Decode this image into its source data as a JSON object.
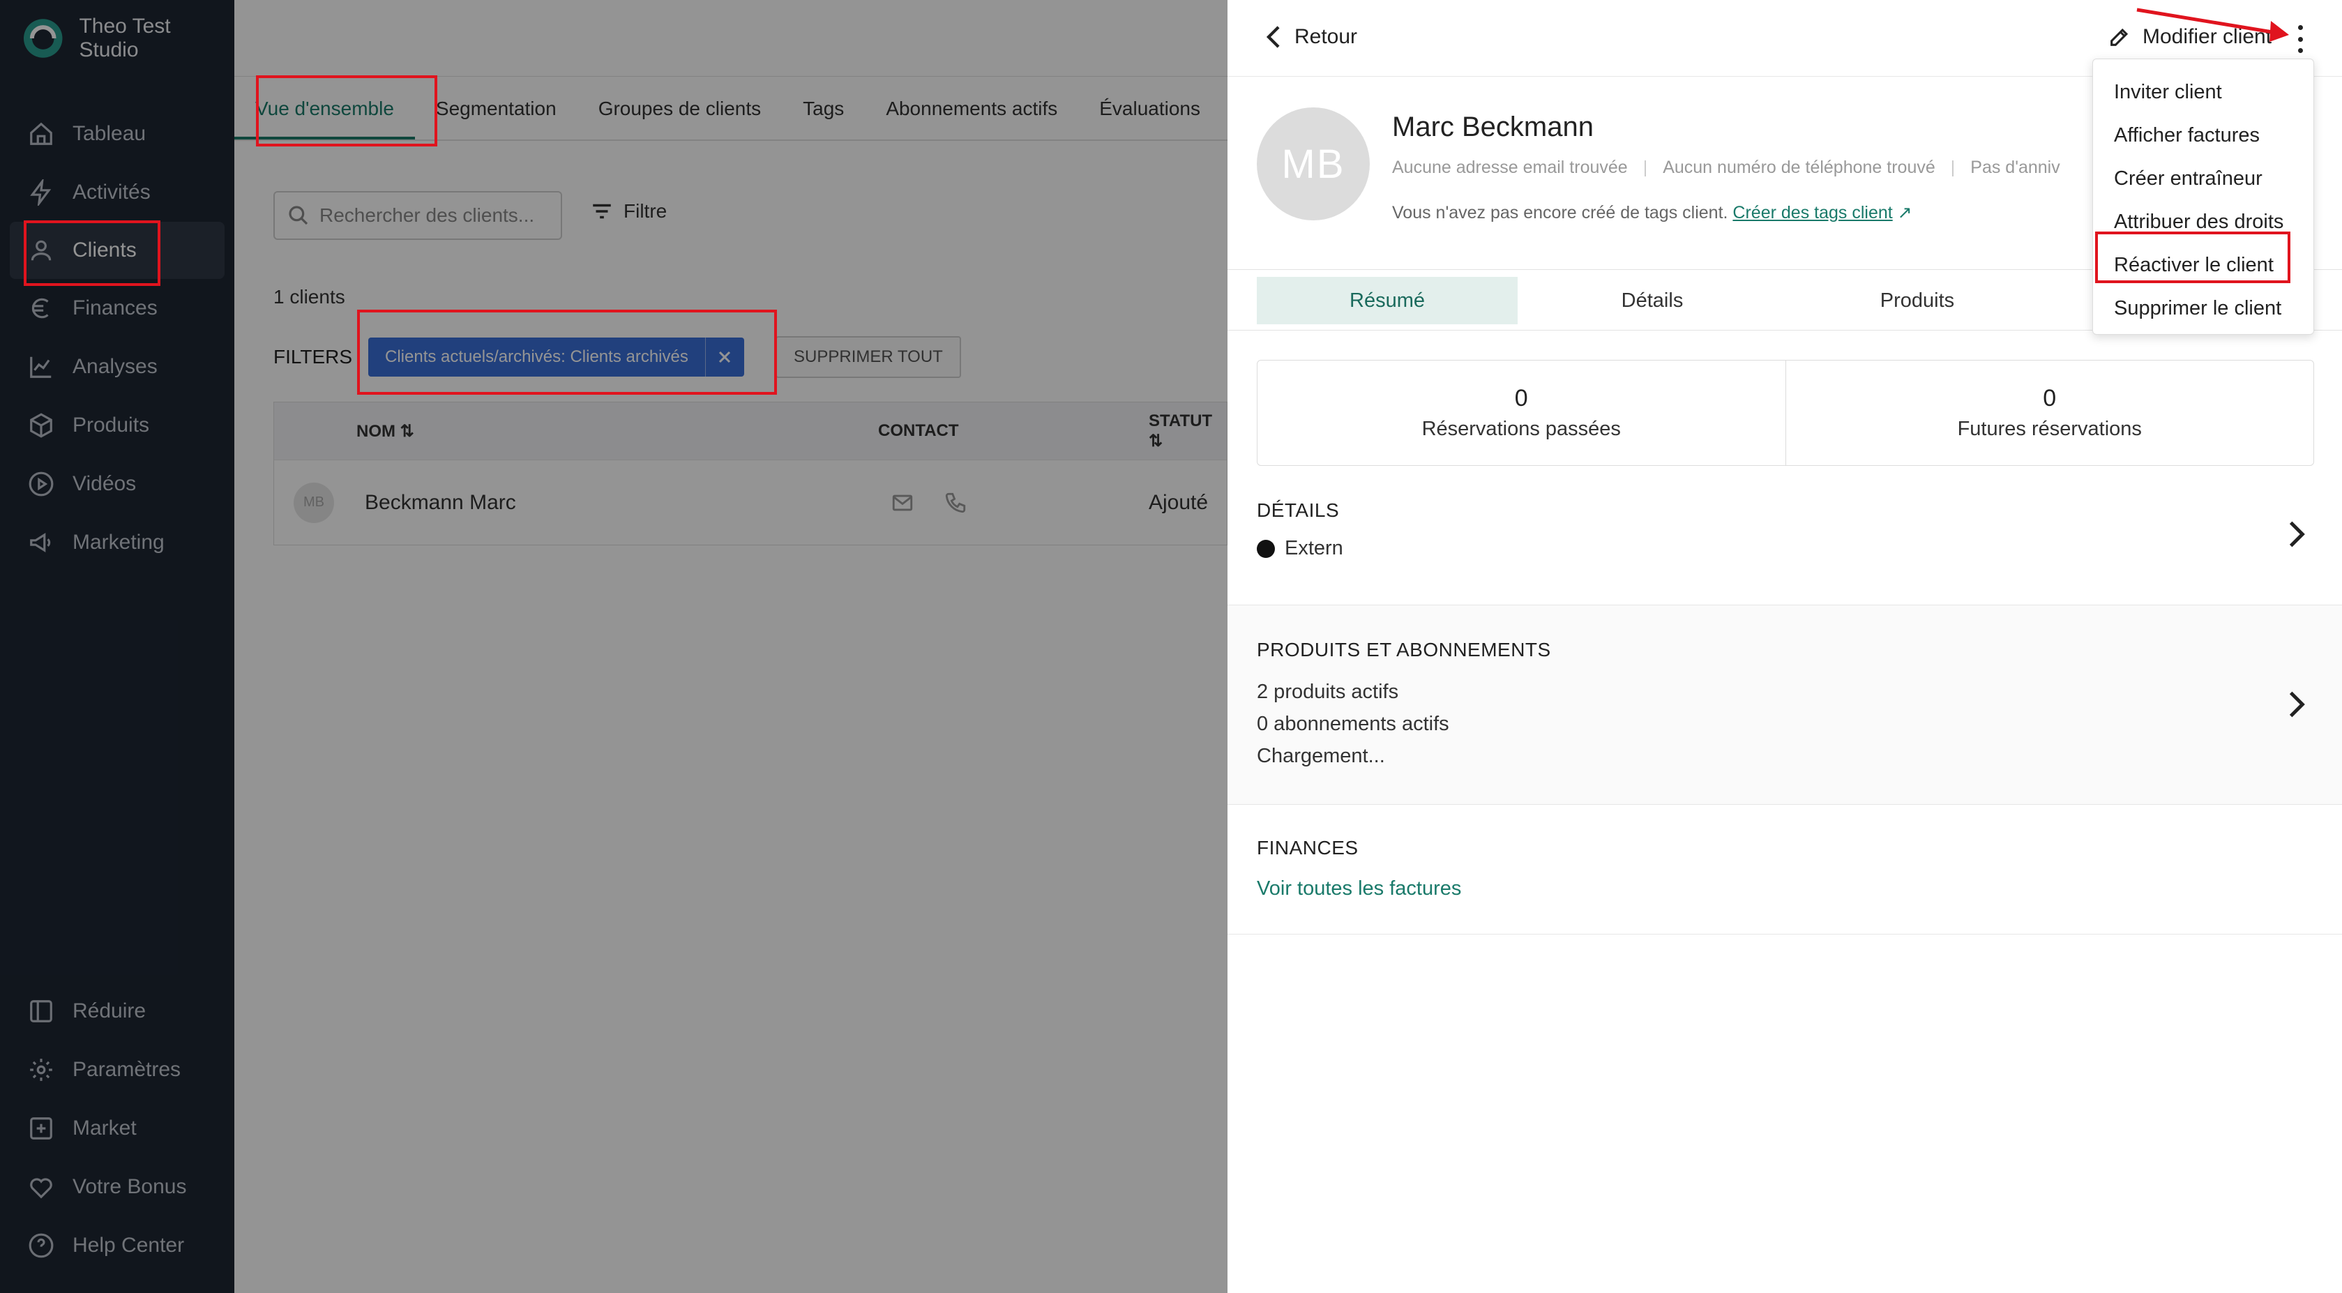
{
  "brand": {
    "name": "Theo Test Studio"
  },
  "sidebar": {
    "items": [
      {
        "label": "Tableau",
        "icon": "home-icon"
      },
      {
        "label": "Activités",
        "icon": "bolt-icon"
      },
      {
        "label": "Clients",
        "icon": "user-icon",
        "active": true
      },
      {
        "label": "Finances",
        "icon": "euro-icon"
      },
      {
        "label": "Analyses",
        "icon": "chart-line-icon"
      },
      {
        "label": "Produits",
        "icon": "box-icon"
      },
      {
        "label": "Vidéos",
        "icon": "play-circle-icon"
      },
      {
        "label": "Marketing",
        "icon": "megaphone-icon"
      }
    ],
    "bottom": [
      {
        "label": "Réduire",
        "icon": "collapse-icon"
      },
      {
        "label": "Paramètres",
        "icon": "gear-icon"
      },
      {
        "label": "Market",
        "icon": "plus-square-icon"
      },
      {
        "label": "Votre Bonus",
        "icon": "heart-icon"
      },
      {
        "label": "Help Center",
        "icon": "help-circle-icon"
      }
    ]
  },
  "main": {
    "tabs": [
      {
        "label": "Vue d'ensemble",
        "active": true
      },
      {
        "label": "Segmentation"
      },
      {
        "label": "Groupes de clients"
      },
      {
        "label": "Tags"
      },
      {
        "label": "Abonnements actifs"
      },
      {
        "label": "Évaluations"
      }
    ],
    "search_placeholder": "Rechercher des clients...",
    "filter_label": "Filtre",
    "count_text": "1 clients",
    "filters_label": "FILTERS",
    "chip": {
      "key": "Clients actuels/archivés:",
      "value": "Clients archivés"
    },
    "clear_all": "SUPPRIMER TOUT",
    "table": {
      "headers": {
        "name": "NOM",
        "contact": "CONTACT",
        "status": "STATUT"
      },
      "rows": [
        {
          "initials": "MB",
          "name": "Beckmann Marc",
          "status": "Ajouté"
        }
      ]
    }
  },
  "drawer": {
    "back_label": "Retour",
    "edit_label": "Modifier client",
    "client": {
      "initials": "MB",
      "name": "Marc Beckmann",
      "email": "Aucune adresse email trouvée",
      "phone": "Aucun numéro de téléphone trouvé",
      "birthday": "Pas d'anniv",
      "tags_text": "Vous n'avez pas encore créé de tags client.",
      "tags_link": "Créer des tags client"
    },
    "tabs": [
      {
        "label": "Résumé",
        "active": true
      },
      {
        "label": "Détails"
      },
      {
        "label": "Produits"
      }
    ],
    "stats": [
      {
        "value": "0",
        "label": "Réservations passées"
      },
      {
        "value": "0",
        "label": "Futures réservations"
      }
    ],
    "details": {
      "title": "DÉTAILS",
      "tag": "Extern"
    },
    "products": {
      "title": "PRODUITS ET ABONNEMENTS",
      "lines": [
        "2 produits actifs",
        "0 abonnements actifs",
        "Chargement..."
      ]
    },
    "finances": {
      "title": "FINANCES",
      "link": "Voir toutes les factures"
    },
    "menu": [
      "Inviter client",
      "Afficher factures",
      "Créer entraîneur",
      "Attribuer des droits",
      "Réactiver le client",
      "Supprimer le client"
    ]
  },
  "colors": {
    "accent": "#1a7a6a",
    "sidebar_bg": "#1e2633",
    "chip": "#3a6fd8",
    "annotation": "#e0141e"
  }
}
